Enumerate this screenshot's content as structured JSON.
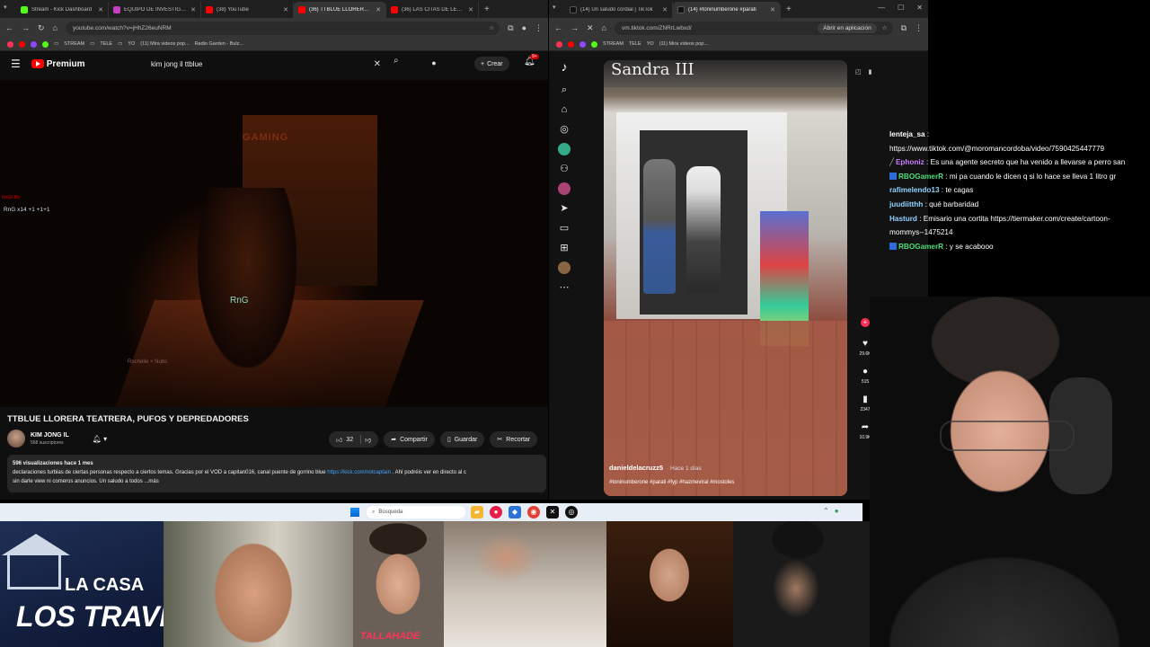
{
  "left_browser": {
    "tabs": [
      {
        "label": "Stream - Kick Dashboard",
        "color": "#53fc18"
      },
      {
        "label": "EQUIPO DE INVESTIGAC",
        "color": "#c040c0"
      },
      {
        "label": "(38) YouTube",
        "color": "#ff0000"
      },
      {
        "label": "(36) TTBLUE LLORERA TE",
        "color": "#ff0000"
      },
      {
        "label": "(36) LAS CITAS DE LEYEN",
        "color": "#ff0000"
      }
    ],
    "url": "youtube.com/watch?v=jHhZ26euNRM",
    "bookmarks": [
      "STREAM",
      "TELE",
      "YO",
      "(11) Mira videos pop...",
      "Radio Garden - Bulz..."
    ]
  },
  "youtube": {
    "brand": "Premium",
    "search_value": "kim jong il ttblue",
    "create_label": "Crear",
    "notif_count": "9+",
    "video": {
      "sign": "GAMING",
      "player_tag": "RnG",
      "hud_name": "RnG x14  +1 +1+1",
      "hud_red": "RnGKBlz",
      "hud_bottom": "Rochelle  ×  Nubs"
    },
    "title": "TTBLUE LLORERA TEATRERA, PUFOS Y DEPREDADORES",
    "channel": {
      "name": "KIM JONG IL",
      "subs": "568 suscriptores"
    },
    "likes": "32",
    "share": "Compartir",
    "save": "Guardar",
    "clip": "Recortar",
    "desc_meta": "596 visualizaciones  hace 1 mes",
    "desc_line1": "declaraciones turbias de ciertas personas respecto a ciertos temas. Gracias por el VOD a capitan016, canal puente de gorrino blue ",
    "desc_link": "https://kick.com/notcaptain",
    "desc_line1b": " . Ahí podréis ver en directo al c",
    "desc_line2": "sin darle view ni comeros anuncios. Un saludo a todos ...más"
  },
  "right_browser": {
    "tabs": [
      {
        "label": "(14) Un saludo cordial | TikTok",
        "color": "#111111"
      },
      {
        "label": "(14) #toninumberone #parati",
        "color": "#111111"
      }
    ],
    "url": "vm.tiktok.com/ZNRrLwbxd/",
    "open_in_app": "Abrir en aplicación",
    "bookmarks": [
      "STREAM",
      "TELE",
      "YO",
      "(11) Mira videos pop..."
    ]
  },
  "tiktok": {
    "sign": "Sandra III",
    "username": "danieldelacruzz5",
    "time_ago": "· Hace 1 días",
    "tags": "#toninumberone #parati #fyp #hazmeviral #mostoles",
    "likes": "29.6K",
    "comments": "515",
    "saves": "2347",
    "shares": "10.9K"
  },
  "chat": [
    {
      "user": "lenteja_sa",
      "text": " :",
      "color": "#ffffff",
      "badge": false
    },
    {
      "user": "",
      "text": "https://www.tiktok.com/@moromancordoba/video/7590425447779",
      "color": "#ffffff",
      "badge": false
    },
    {
      "user": "Ephoniz",
      "text": " : Es una agente secreto que ha venido a llevarse a perro san",
      "color": "#c77dff",
      "badge": false
    },
    {
      "user": "RBOGamerR",
      "text": " : mi pa cuando le dicen q si lo hace se lleva 1 litro gr",
      "color": "#4ddd7c",
      "badge": true
    },
    {
      "user": "rafimelendo13",
      "text": " : te cagas",
      "color": "#8fd3ff",
      "badge": false
    },
    {
      "user": "juudiitthh",
      "text": " : qué barbaridad",
      "color": "#8fd3ff",
      "badge": false
    },
    {
      "user": "Hasturd",
      "text": " : Emisario una cortita https://tiermaker.com/create/cartoon-",
      "color": "#8fd3ff",
      "badge": false
    },
    {
      "user": "",
      "text": "mommys--1475214",
      "color": "#ffffff",
      "badge": false
    },
    {
      "user": "RBOGamerR",
      "text": " : y se acabooo",
      "color": "#4ddd7c",
      "badge": true
    }
  ],
  "taskbar": {
    "search_placeholder": "Búsqueda"
  },
  "thumbnails": {
    "house_line1": "LA CASA",
    "house_line2": "LOS TRAVELO",
    "tallahade": "TALLAHADE"
  }
}
